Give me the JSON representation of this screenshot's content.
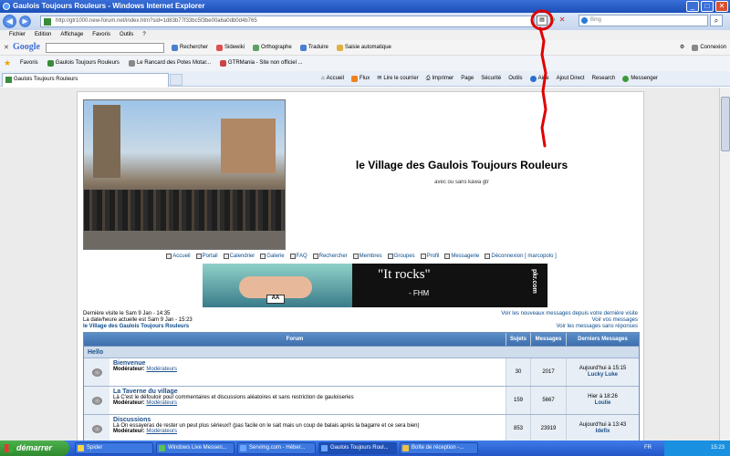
{
  "window": {
    "title": "Gaulois Toujours Rouleurs - Windows Internet Explorer",
    "buttons": [
      "_",
      "□",
      "✕"
    ]
  },
  "address": {
    "url": "http://gtr1000.new-forum.net/index.htm?sid=1d83b77f33bc5f3be00a6a0db0d4b765",
    "search_placeholder": "Bing"
  },
  "menu": [
    "Fichier",
    "Edition",
    "Affichage",
    "Favoris",
    "Outils",
    "?"
  ],
  "googlebar": {
    "logo": "Google",
    "items": [
      "Rechercher",
      "Sidewiki",
      "Orthographe",
      "Traduire",
      "Saisie automatique"
    ],
    "right": [
      "Connexion"
    ]
  },
  "favorites": {
    "label": "Favoris",
    "items": [
      "Gaulois Toujours Rouleurs",
      "Le Rancard des Potes Motar...",
      "GTRMania - Site non officiel ..."
    ]
  },
  "tab": {
    "label": "Gaulois Toujours Rouleurs"
  },
  "commands": [
    "Accueil",
    "Flux",
    "Lire le courrier",
    "Imprimer",
    "Page",
    "Sécurité",
    "Outils",
    "Aide",
    "Ajout Direct",
    "Research",
    "Messenger"
  ],
  "page": {
    "site_title": "le Village des Gaulois Toujours Rouleurs",
    "site_subtitle": "avec ou sans kawa gtr",
    "nav": [
      "Accueil",
      "Portail",
      "Calendrier",
      "Galerie",
      "FAQ",
      "Rechercher",
      "Membres",
      "Groupes",
      "Profil",
      "Messagerie",
      "Déconnexion [ marcopolo ]"
    ],
    "banner": {
      "quote": "\"It rocks\"",
      "source": "- FHM",
      "brand": "pkr.com",
      "cards": "AA"
    },
    "last_visit": "Dernière visite le Sam 9 Jan - 14:35",
    "current_time": "La date/heure actuelle est Sam 9 Jan - 15:23",
    "forum_link": "le Village des Gaulois Toujours Rouleurs",
    "right_links": [
      "Voir les nouveaux messages depuis votre dernière visite",
      "Voir vos messages",
      "Voir les messages sans réponses"
    ],
    "table": {
      "headers": {
        "forum": "Forum",
        "subjects": "Sujets",
        "messages": "Messages",
        "last": "Derniers Messages"
      },
      "category": "Hello",
      "moderator_label": "Modérateur:",
      "rows": [
        {
          "name": "Bienvenue",
          "desc": "",
          "moderator": "Modérateurs",
          "subjects": "30",
          "messages": "2017",
          "last_date": "Aujourd'hui à 15:15",
          "last_user": "Lucky Luke"
        },
        {
          "name": "La Taverne du village",
          "desc": "Là C'est le défouloir pour commentaires et discussions aléatoires et sans restriction de gauloiseries",
          "moderator": "Modérateurs",
          "subjects": "159",
          "messages": "5667",
          "last_date": "Hier à 18:26",
          "last_user": "Loulie"
        },
        {
          "name": "Discussions",
          "desc": "Là On essayeras de rester un peut plus sérieux!! (pas facile on le sait mais un coup de balais après la bagarre et ce sera bien)",
          "moderator": "Modérateurs",
          "subjects": "853",
          "messages": "23919",
          "last_date": "Aujourd'hui à 13:43",
          "last_user": "Idefix"
        }
      ]
    }
  },
  "taskbar": {
    "start": "démarrer",
    "tasks": [
      "Spider",
      "Windows Live Messen...",
      "Servimg.com - Héber...",
      "Gaulois Toujours Roul...",
      "Boîte de réception -..."
    ],
    "lang": "FR",
    "clock": "15:23"
  },
  "colors": {
    "annotation": "#e00000",
    "forum_header": "#3f6fae",
    "link": "#0a4b8c"
  }
}
